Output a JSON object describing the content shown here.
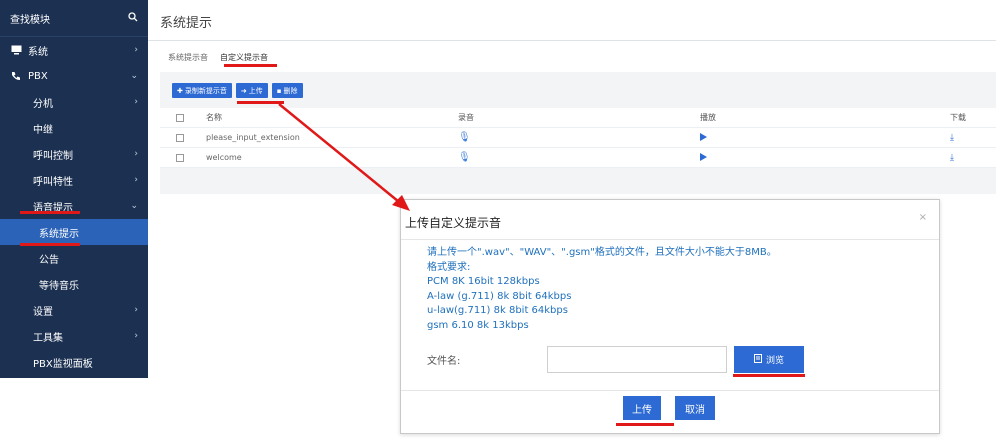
{
  "sidebar": {
    "search_label": "查找模块",
    "items": [
      {
        "label": "系统",
        "icon": "monitor-icon",
        "chevron": "›"
      },
      {
        "label": "PBX",
        "icon": "phone-icon",
        "chevron": "⌄"
      },
      {
        "label": "分机",
        "chevron": "›"
      },
      {
        "label": "中继",
        "chevron": ""
      },
      {
        "label": "呼叫控制",
        "chevron": "›"
      },
      {
        "label": "呼叫特性",
        "chevron": "›"
      },
      {
        "label": "语音提示",
        "chevron": "⌄"
      },
      {
        "label": "系统提示",
        "chevron": ""
      },
      {
        "label": "公告",
        "chevron": ""
      },
      {
        "label": "等待音乐",
        "chevron": ""
      },
      {
        "label": "设置",
        "chevron": "›"
      },
      {
        "label": "工具集",
        "chevron": "›"
      },
      {
        "label": "PBX监视面板",
        "chevron": ""
      }
    ]
  },
  "page": {
    "title": "系统提示",
    "tabs": [
      "系统提示音",
      "自定义提示音"
    ]
  },
  "toolbar": {
    "record_label": "录制新提示音",
    "upload_label": "上传",
    "delete_label": "删除"
  },
  "table": {
    "headers": [
      "名称",
      "录音",
      "播放",
      "下载"
    ],
    "rows": [
      {
        "name": "please_input_extension"
      },
      {
        "name": "welcome"
      }
    ]
  },
  "modal": {
    "title": "上传自定义提示音",
    "hint_lines": [
      "请上传一个\".wav\"、\"WAV\"、\".gsm\"格式的文件，且文件大小不能大于8MB。",
      "格式要求:",
      "PCM 8K 16bit 128kbps",
      "A-law  (g.711) 8k 8bit 64kbps",
      "u-law(g.711) 8k 8bit 64kbps",
      "gsm 6.10 8k 13kbps"
    ],
    "file_label": "文件名:",
    "file_value": "",
    "browse_label": "浏览",
    "ok_label": "上传",
    "cancel_label": "取消"
  },
  "colors": {
    "sidebar_bg": "#1c3152",
    "sidebar_active": "#2a63b8",
    "primary": "#2d6ad3",
    "hint_text": "#1f70bd",
    "highlight": "#e01818"
  }
}
